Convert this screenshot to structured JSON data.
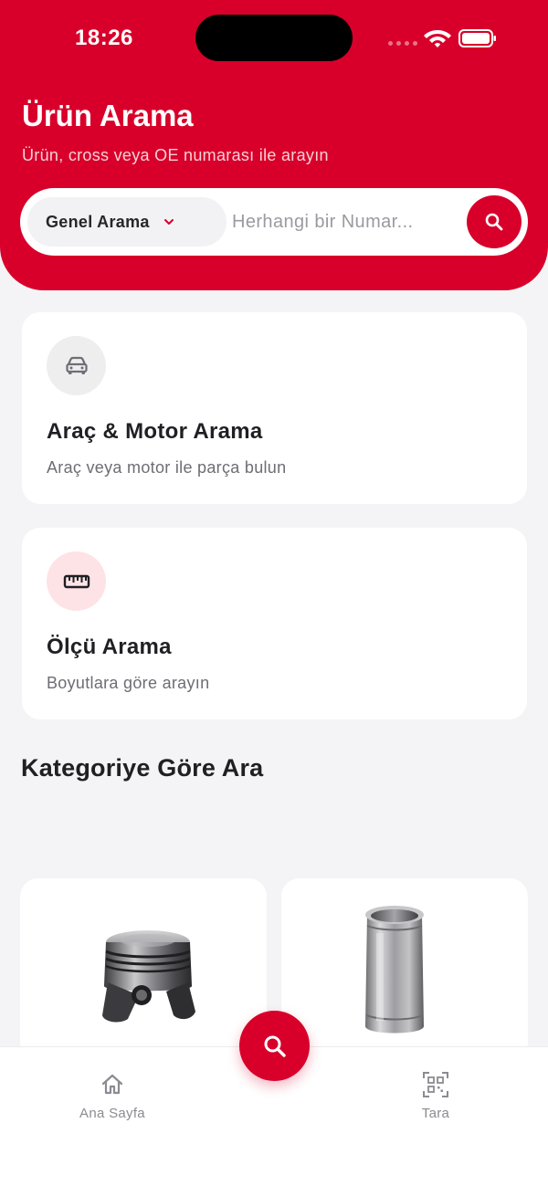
{
  "status_bar": {
    "time": "18:26"
  },
  "header": {
    "title": "Ürün Arama",
    "subtitle": "Ürün, cross veya OE numarası ile arayın"
  },
  "search": {
    "type_label": "Genel Arama",
    "placeholder": "Herhangi bir Numar..."
  },
  "cards": [
    {
      "title": "Araç & Motor Arama",
      "description": "Araç veya motor ile parça bulun",
      "icon": "car-icon"
    },
    {
      "title": "Ölçü Arama",
      "description": "Boyutlara göre arayın",
      "icon": "ruler-icon"
    }
  ],
  "categories": {
    "title": "Kategoriye Göre Ara",
    "items": [
      {
        "icon": "piston-image"
      },
      {
        "icon": "cylinder-liner-image"
      }
    ]
  },
  "tab_bar": {
    "home_label": "Ana Sayfa",
    "scan_label": "Tara",
    "fab_icon": "search-icon"
  },
  "colors": {
    "brand": "#d8002a",
    "background": "#f4f4f6",
    "card": "#ffffff",
    "muted_text": "#6d6d73"
  }
}
